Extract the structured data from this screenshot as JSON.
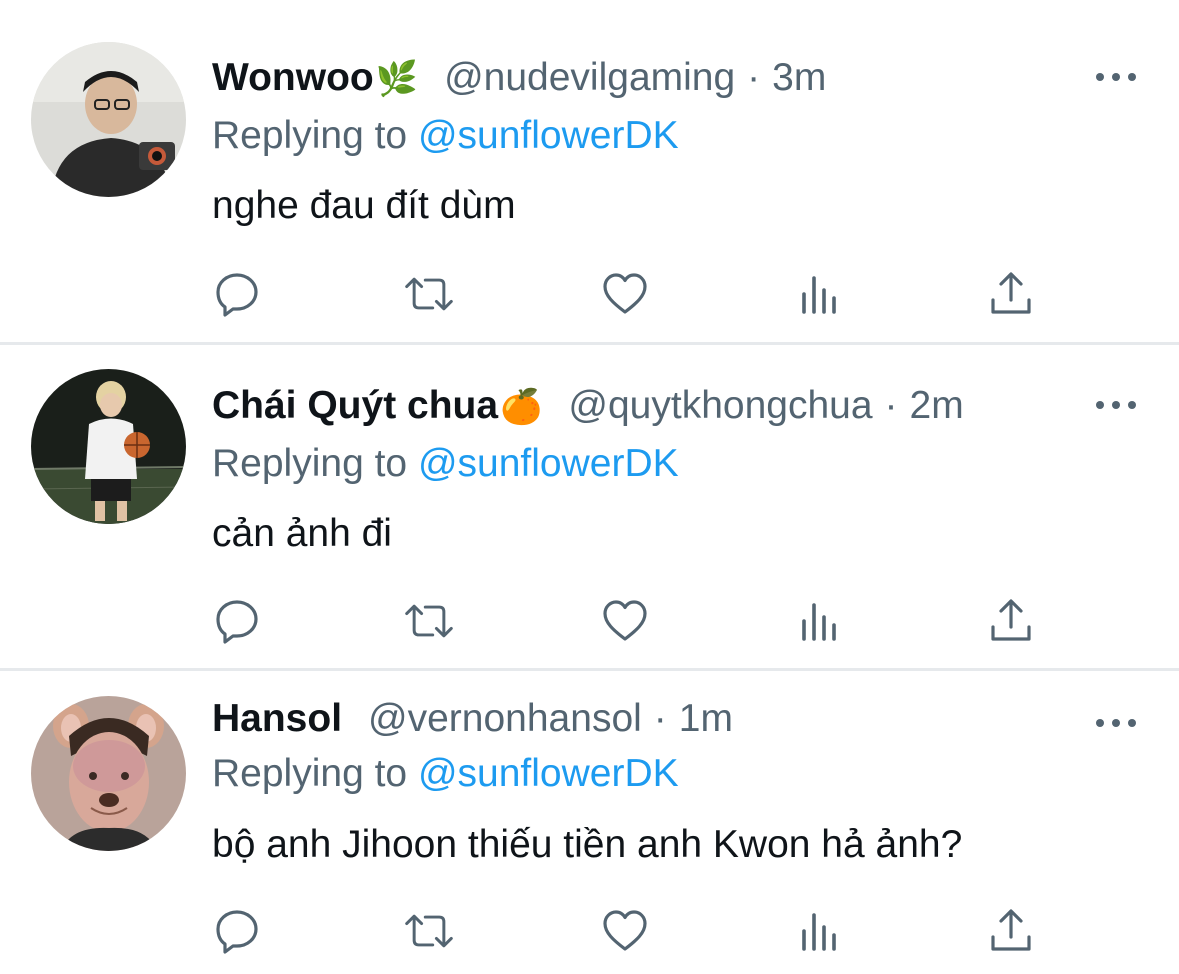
{
  "tweets": [
    {
      "name": "Wonwoo",
      "emoji": "🌿",
      "handle": "@nudevilgaming",
      "separator": "·",
      "time": "3m",
      "replying_prefix": "Replying to ",
      "replying_to": "@sunflowerDK",
      "text": "nghe đau đít dùm"
    },
    {
      "name": "Chái Quýt chua",
      "emoji": "🍊",
      "handle": "@quytkhongchua",
      "separator": "·",
      "time": "2m",
      "replying_prefix": "Replying to ",
      "replying_to": "@sunflowerDK",
      "text": "cản ảnh đi"
    },
    {
      "name": "Hansol",
      "emoji": "",
      "handle": "@vernonhansol",
      "separator": "·",
      "time": "1m",
      "replying_prefix": "Replying to ",
      "replying_to": "@sunflowerDK",
      "text": "bộ anh Jihoon thiếu tiền anh Kwon hả ảnh?"
    }
  ],
  "actions": [
    "reply-icon",
    "retweet-icon",
    "like-icon",
    "analytics-icon",
    "share-icon"
  ],
  "colors": {
    "text": "#0f1419",
    "secondary": "#536471",
    "link": "#1d9bf0",
    "divider": "#e6e9ec"
  }
}
